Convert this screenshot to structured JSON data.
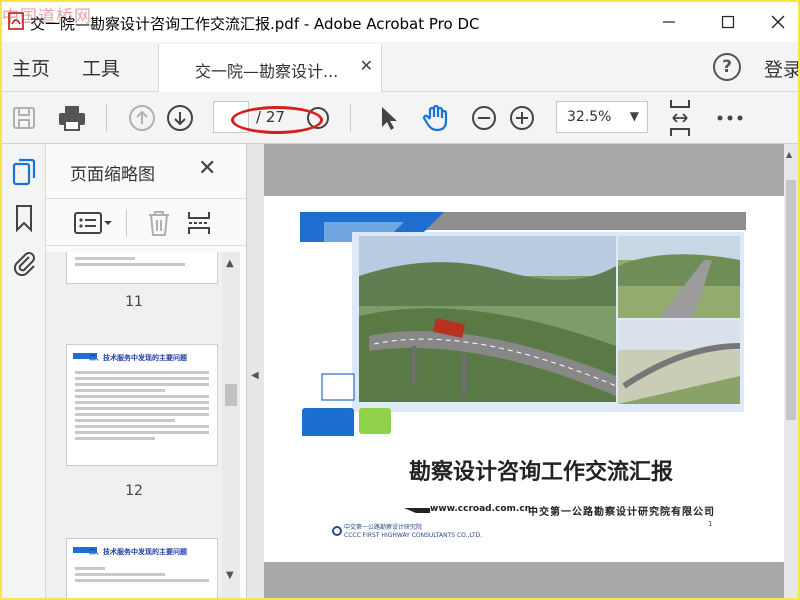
{
  "watermark": "中国道桥网",
  "window": {
    "title": "交一院—勘察设计咨询工作交流汇报.pdf - Adobe Acrobat Pro DC"
  },
  "menu": {
    "home": "主页",
    "tools": "工具",
    "doc_tab": "交一院—勘察设计...",
    "login": "登录"
  },
  "toolbar": {
    "page_total": "/ 27",
    "zoom": "32.5%"
  },
  "panel": {
    "title": "页面缩略图",
    "thumbnails": [
      {
        "number": "11",
        "heading": ""
      },
      {
        "number": "12",
        "heading": "二、技术服务中发现的主要问题"
      },
      {
        "number": "",
        "heading": "二、技术服务中发现的主要问题"
      }
    ]
  },
  "slide": {
    "title": "勘察设计咨询工作交流汇报",
    "url": "www.ccroad.com.cn",
    "company": "中交第一公路勘察设计研究院有限公司",
    "footer_cn": "中交第一公路勘察设计研究院",
    "footer_en": "CCCC FIRST HIGHWAY CONSULTANTS CO.,LTD.",
    "page_number": "1"
  },
  "colors": {
    "annotation_red": "#d62020",
    "accent_blue": "#1f6fd1",
    "accent_green": "#8fd24a"
  }
}
